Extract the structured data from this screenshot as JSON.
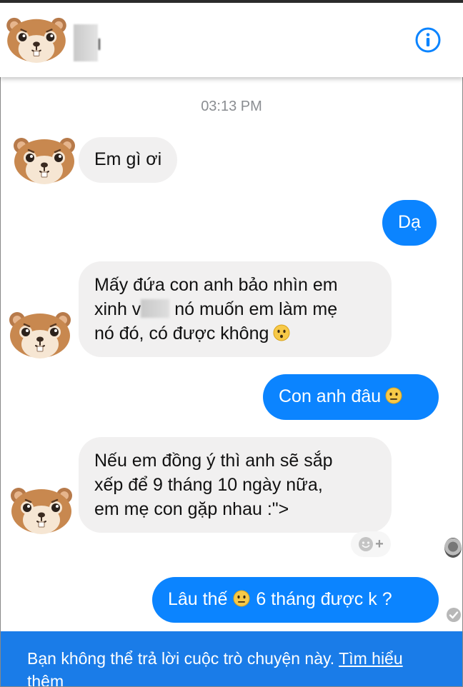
{
  "header": {
    "contact_avatar_icon": "hamster-avatar-icon",
    "info_icon": "info-circle-icon"
  },
  "conversation": {
    "timestamp": "03:13 PM",
    "messages": [
      {
        "side": "in",
        "lines": [
          "Em gì ơi"
        ]
      },
      {
        "side": "out",
        "lines": [
          "Dạ"
        ]
      },
      {
        "side": "in",
        "lines": [
          "Mấy đứa con anh bảo nhìn em",
          "xinh v",
          "nó muốn em làm mẹ",
          "nó đó, có được không"
        ],
        "emoji": "hushed-face-emoji"
      },
      {
        "side": "out",
        "lines": [
          "Con anh đâu"
        ],
        "emoji": "neutral-face-emoji"
      },
      {
        "side": "in",
        "lines": [
          "Nếu em đồng ý thì anh sẽ sắp",
          "xếp để 9 tháng 10 ngày nữa,",
          "em mẹ con gặp nhau :\">"
        ]
      },
      {
        "side": "out",
        "lines": [
          "Lâu thế",
          "6 tháng được k ?"
        ],
        "emoji": "neutral-face-emoji"
      }
    ]
  },
  "reaction_button": {
    "icon": "add-reaction-icon",
    "plus": "+"
  },
  "footer": {
    "notice": "Bạn không thể trả lời cuộc trò chuyện này.",
    "link_part1": "Tìm hiểu",
    "link_part2": "thêm"
  },
  "colors": {
    "outgoing_bubble": "#0b84ff",
    "incoming_bubble": "#f1f0f0",
    "footer_bar": "#1a7ce8",
    "info_icon": "#0b84ff"
  }
}
